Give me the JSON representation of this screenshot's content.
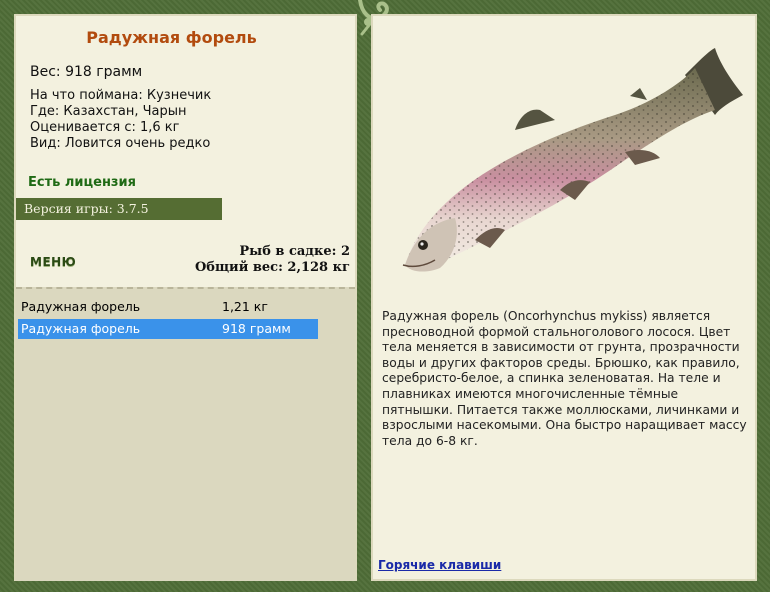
{
  "fish": {
    "title": "Радужная форель",
    "weight": "Вес: 918 грамм",
    "bait": "На что поймана: Кузнечик",
    "location": "Где: Казахстан, Чарын",
    "value": "Оценивается с: 1,6 кг",
    "rarity": "Вид: Ловится очень редко"
  },
  "license": "Есть лицензия",
  "version": "Версия игры: 3.7.5",
  "menu_label": "МЕНЮ",
  "stats": {
    "fish_count": "Рыб в садке: 2",
    "total_weight": "Общий вес: 2,128 кг"
  },
  "catch_list": [
    {
      "name": "Радужная форель",
      "weight": "1,21 кг",
      "selected": false
    },
    {
      "name": "Радужная форель",
      "weight": "918 грамм",
      "selected": true
    }
  ],
  "description": "Радужная форель (Oncorhynchus mykiss) является пресноводной формой стальноголового лосося. Цвет тела меняется в зависимости от грунта, прозрачности воды и других факторов среды. Брюшко, как правило, серебристо-белое, а спинка зеленоватая. На теле и плавниках имеются многочисленные тёмные пятнышки. Питается также моллюсками, личинками и взрослыми насекомыми. Она быстро наращивает массу тела до 6-8 кг.",
  "hotkeys_link": "Горячие клавиши",
  "colors": {
    "frame": "#4f6d37",
    "panel": "#f3f1df",
    "title": "#b24b0e",
    "license": "#1f6a15",
    "selection": "#3a92ea",
    "link": "#1a2aa8"
  },
  "icons": [
    "chameleon-ornament-icon",
    "rainbow-trout-illustration"
  ]
}
